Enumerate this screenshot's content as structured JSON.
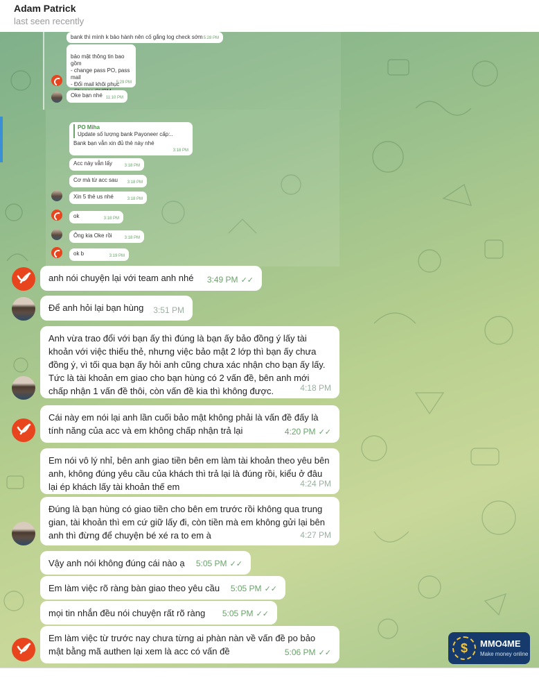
{
  "header": {
    "name": "Adam Patrick",
    "status": "last seen recently"
  },
  "embedded": {
    "top": [
      {
        "text": "bank thì mình k bảo hành nên cố gắng log check sớm",
        "time": "5:28 PM"
      },
      {
        "text": "bảo mật thông tin bao gồm\n- change pass PO, pass mail\n- Đổi mail khôi phục\n- Change CHBM",
        "time": "5:29 PM",
        "reactions": "❤️🙈"
      },
      {
        "text": "Oke bạn nhé",
        "time": "11:10 PM"
      }
    ],
    "quote": {
      "author": "PO Miha",
      "text": "Update số lượng bank Payoneer cấp:..",
      "reply": "Bank bạn vẫn xin đủ thẻ này nhé",
      "time": "3:18 PM"
    },
    "list": [
      {
        "text": "Acc này vẫn lấy",
        "time": "3:18 PM"
      },
      {
        "text": "Cơ mà từ acc sau",
        "time": "3:18 PM"
      },
      {
        "text": "Xin 5 thẻ us nhé",
        "time": "3:18 PM"
      },
      {
        "text": "ok",
        "time": "3:18 PM"
      },
      {
        "text": "Ông kia Oke rồi",
        "time": "3:18 PM"
      },
      {
        "text": "ok b",
        "time": "3:19 PM"
      }
    ]
  },
  "messages": [
    {
      "text": "anh nói chuyện lại với team anh nhé",
      "time": "3:49 PM",
      "ticks": "✓✓"
    },
    {
      "text": "Để anh hỏi lại bạn hùng",
      "time": "3:51 PM",
      "ticks": ""
    },
    {
      "text": "Anh vừa trao đổi với bạn ấy thì đúng là bạn ấy bảo đồng ý lấy tài khoản với việc thiếu thẻ, nhưng việc bảo mật 2 lớp thì bạn ấy chưa đồng ý, vì tối qua bạn ấy hỏi anh cũng chưa xác nhận cho bạn ấy lấy. Tức là tài khoản em giao cho bạn hùng có 2 vấn đề, bên anh mới chấp nhận 1 vấn đề thôi, còn vấn đề kia thì không được.",
      "time": "4:18 PM",
      "ticks": ""
    },
    {
      "text": "Cái này em nói lại anh lần cuối bảo mật không phải là vấn đề đấy là tính năng của acc và em không chấp nhận trả lại",
      "time": "4:20 PM",
      "ticks": "✓✓"
    },
    {
      "text": "Em nói vô lý nhỉ, bên anh giao tiền bên em làm tài khoản theo yêu bên anh, không đúng yêu cầu của khách thì trả lại là đúng rồi, kiểu ở đâu lại ép khách lấy tài khoản thế em",
      "time": "4:24 PM",
      "ticks": ""
    },
    {
      "text": "Đúng là bạn hùng có giao tiền cho bên em trước rồi không qua trung gian, tài khoản thì em cứ giữ lấy đi, còn tiền mà em không gửi lại bên anh thì đừng để chuyện bé xé ra to em à",
      "time": "4:27 PM",
      "ticks": ""
    },
    {
      "text": "Vậy anh nói không đúng cái nào ạ",
      "time": "5:05 PM",
      "ticks": "✓✓"
    },
    {
      "text": "Em làm việc rõ ràng bàn giao theo yêu cầu",
      "time": "5:05 PM",
      "ticks": "✓✓"
    },
    {
      "text": "mọi tin nhắn đều nói chuyện rất rõ ràng",
      "time": "5:05 PM",
      "ticks": "✓✓"
    },
    {
      "text": "Em làm việc từ trước nay chưa từng ai phàn nàn về vấn đề po bảo mật bằng mã authen lại xem là acc có vấn đề",
      "time": "5:06 PM",
      "ticks": "✓✓"
    }
  ],
  "watermark": {
    "brand": "MMO4ME",
    "tagline": "Make money online"
  },
  "colors": {
    "chat_bg": "#a9c88e",
    "outgoing_tick": "#6aa36a",
    "avatar_orange": "#e8451f"
  }
}
